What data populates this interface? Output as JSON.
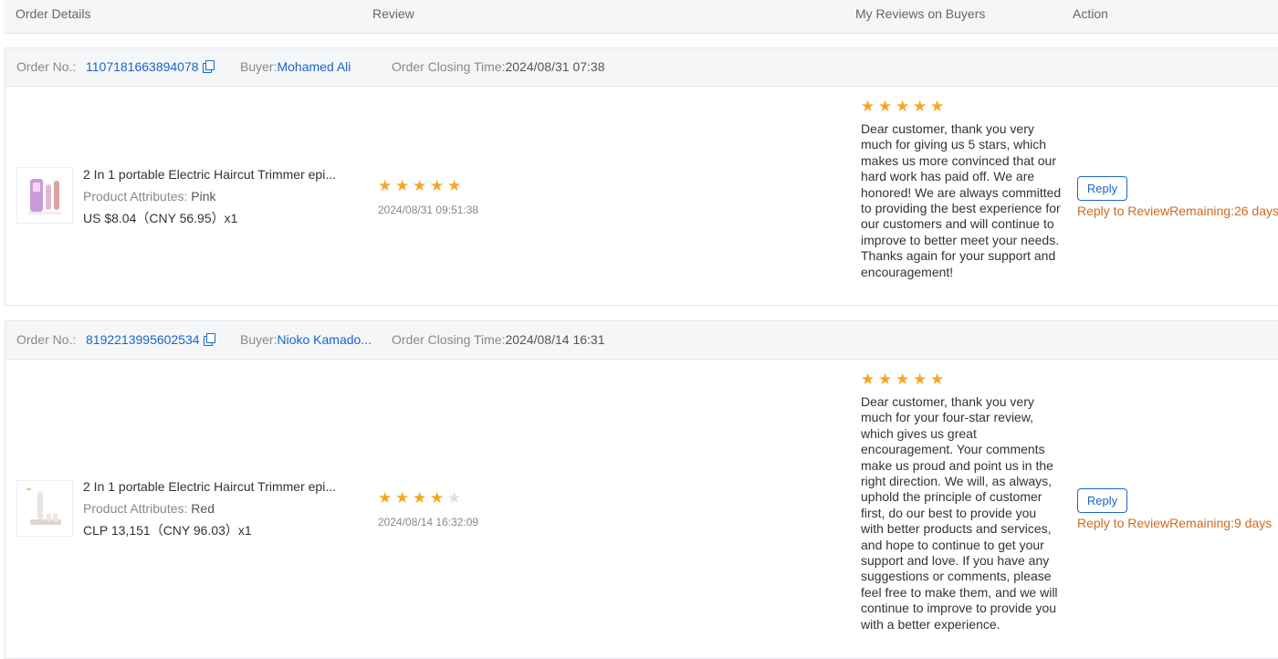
{
  "columns": {
    "order_details": "Order Details",
    "review": "Review",
    "my_reviews": "My Reviews on Buyers",
    "action": "Action"
  },
  "labels": {
    "order_no": "Order No.:",
    "buyer": "Buyer:",
    "closing": "Order Closing Time:",
    "attr_prefix": "Product Attributes:",
    "reply_btn": "Reply",
    "reply_to_review": "Reply to Review"
  },
  "orders": [
    {
      "order_no": "1107181663894078",
      "buyer": "Mohamed Ali",
      "closing_time": "2024/08/31 07:38",
      "product_title": "2 In 1 portable Electric Haircut Trimmer epi...",
      "attribute": "Pink",
      "price": "US $8.04（CNY  56.95）x1",
      "rating": 5,
      "review_date": "2024/08/31 09:51:38",
      "my_rating": 5,
      "my_reply": "Dear customer, thank you very much for giving us 5 stars, which makes us more convinced that our hard work has paid off. We are honored! We are always committed to providing the best experience for our customers and will continue to improve to better meet your needs. Thanks again for your support and encouragement!",
      "remaining": "Remaining:26 days",
      "thumb_color": "#c79ad8"
    },
    {
      "order_no": "8192213995602534",
      "buyer": "Nioko Kamado...",
      "closing_time": "2024/08/14 16:31",
      "product_title": "2 In 1 portable Electric Haircut Trimmer epi...",
      "attribute": "Red",
      "price": "CLP 13,151（CNY  96.03）x1",
      "rating": 4,
      "review_date": "2024/08/14 16:32:09",
      "my_rating": 5,
      "my_reply": "Dear customer, thank you very much for your four-star review, which gives us great encouragement. Your comments make us proud and point us in the right direction. We will, as always, uphold the principle of customer first, do our best to provide you with better products and services, and hope to continue to get your support and love. If you have any suggestions or comments, please feel free to make them, and we will continue to improve to provide you with a better experience.",
      "remaining": "Remaining:9 days",
      "thumb_color": "#e8e4df"
    }
  ],
  "icons": {
    "copy": "copy-icon",
    "star": "star-icon"
  },
  "colors": {
    "link": "#1a66c9",
    "star": "#f5a623",
    "remaining": "#d2691e"
  }
}
